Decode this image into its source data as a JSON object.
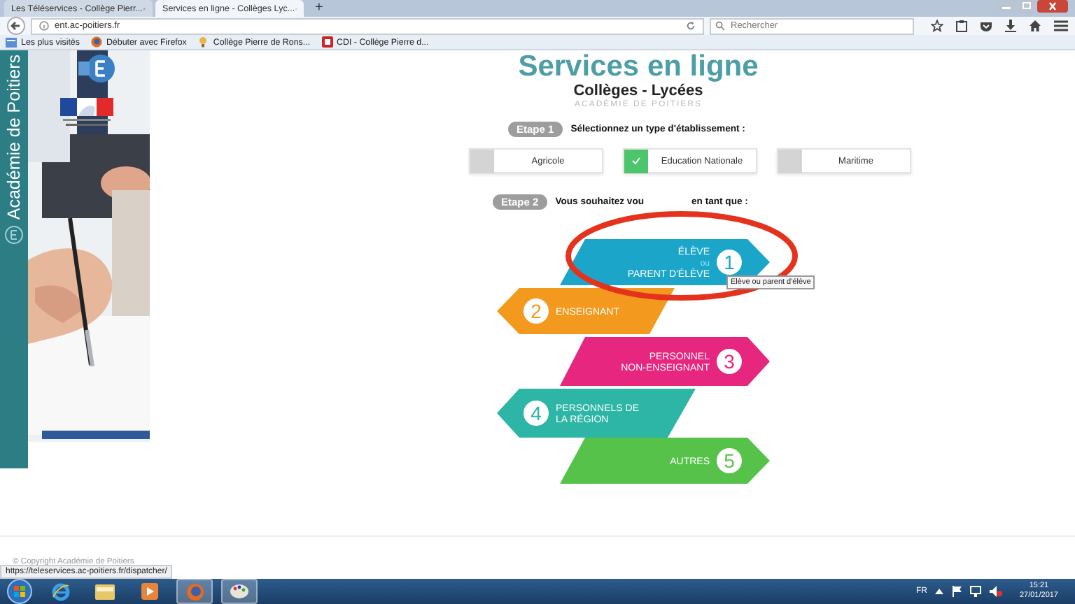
{
  "browser": {
    "tabs": [
      {
        "title": "Les Téléservices - Collège Pierr...",
        "selected": false
      },
      {
        "title": "Services en ligne - Collèges Lyc...",
        "selected": true
      }
    ],
    "new_tab": "+",
    "address": "ent.ac-poitiers.fr",
    "search": {
      "placeholder": "Rechercher"
    },
    "bookmarks": [
      "Les plus visités",
      "Débuter avec Firefox",
      "Collège Pierre de Rons...",
      "CDI - Collège Pierre d..."
    ]
  },
  "sidebar": {
    "title": "Académie de Poitiers"
  },
  "header": {
    "title": "Services en ligne",
    "subtitle": "Collèges - Lycées",
    "caption": "ACADÉMIE DE POITIERS"
  },
  "step1": {
    "badge": "Etape 1",
    "prompt": "Sélectionnez un type d'établissement :",
    "options": [
      {
        "label": "Agricole",
        "selected": false
      },
      {
        "label": "Education Nationale",
        "selected": true
      },
      {
        "label": "Maritime",
        "selected": false
      }
    ]
  },
  "step2": {
    "badge": "Etape 2",
    "prompt_start": "Vous souhaitez vou",
    "prompt_end": "en tant que :",
    "roles": [
      {
        "number": "1",
        "kind": "right",
        "color": "#1ba6c9",
        "lines": [
          "ÉLÈVE",
          "ou",
          "PARENT D'ÉLÈVE"
        ]
      },
      {
        "number": "2",
        "kind": "left",
        "color": "#f39a1e",
        "lines": [
          "ENSEIGNANT"
        ]
      },
      {
        "number": "3",
        "kind": "right",
        "color": "#e6267f",
        "lines": [
          "PERSONNEL",
          "NON-ENSEIGNANT"
        ]
      },
      {
        "number": "4",
        "kind": "left",
        "color": "#2db5a5",
        "lines": [
          "PERSONNELS DE",
          "LA RÉGION"
        ]
      },
      {
        "number": "5",
        "kind": "right",
        "color": "#57c24a",
        "lines": [
          "AUTRES"
        ]
      }
    ],
    "tooltip": "Elève ou parent d'élève"
  },
  "footer": {
    "copyright": "© Copyright Académie de Poitiers"
  },
  "status_url": "https://teleservices.ac-poitiers.fr/dispatcher/",
  "taskbar": {
    "language": "FR",
    "time": "15:21",
    "date": "27/01/2017"
  }
}
